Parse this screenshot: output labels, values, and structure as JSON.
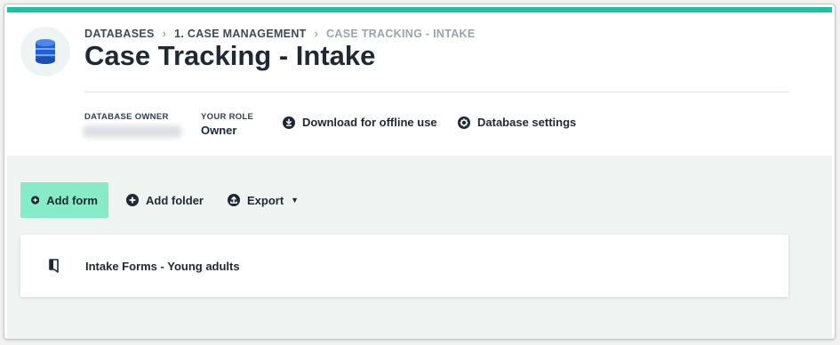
{
  "breadcrumb": {
    "items": [
      "DATABASES",
      "1. CASE MANAGEMENT"
    ],
    "current": "CASE TRACKING - INTAKE"
  },
  "title": "Case Tracking - Intake",
  "meta": {
    "owner_label": "DATABASE OWNER",
    "role_label": "YOUR ROLE",
    "role_value": "Owner",
    "download_label": "Download for offline use",
    "settings_label": "Database settings"
  },
  "toolbar": {
    "add_form_label": "Add form",
    "add_folder_label": "Add folder",
    "export_label": "Export"
  },
  "items": [
    {
      "label": "Intake Forms - Young adults",
      "icon": "form-icon"
    }
  ],
  "colors": {
    "accent_bar": "#1fbfa3",
    "primary_button": "#86ebc7",
    "workarea_bg": "#eff4f3",
    "database_icon": "#1f5fd8"
  }
}
